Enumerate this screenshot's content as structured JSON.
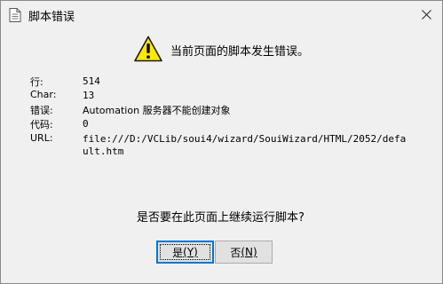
{
  "window": {
    "title": "脚本错误",
    "close_glyph": "✕"
  },
  "dialog": {
    "message": "当前页面的脚本发生错误。",
    "details": [
      {
        "label": "行:",
        "value": "514"
      },
      {
        "label": "Char:",
        "value": "13"
      },
      {
        "label": "错误:",
        "value": "Automation 服务器不能创建对象"
      },
      {
        "label": "代码:",
        "value": "0"
      },
      {
        "label": "URL:",
        "value_line1": "file:///D:/VCLib/soui4/wizard/SouiWizard/HTML/2052/defa",
        "value_line2": "ult.htm"
      }
    ],
    "question": "是否要在此页面上继续运行脚本?",
    "buttons": {
      "yes_label": "是",
      "yes_accel": "(Y)",
      "no_label": "否",
      "no_accel": "(N)"
    }
  },
  "icons": {
    "title": "document-icon",
    "warning": "warning-icon",
    "close": "close-icon"
  },
  "colors": {
    "background": "#f0f0f0",
    "button_face": "#e1e1e1",
    "button_border": "#adadad",
    "default_border": "#0078d7",
    "warning_yellow": "#ffeb00"
  }
}
